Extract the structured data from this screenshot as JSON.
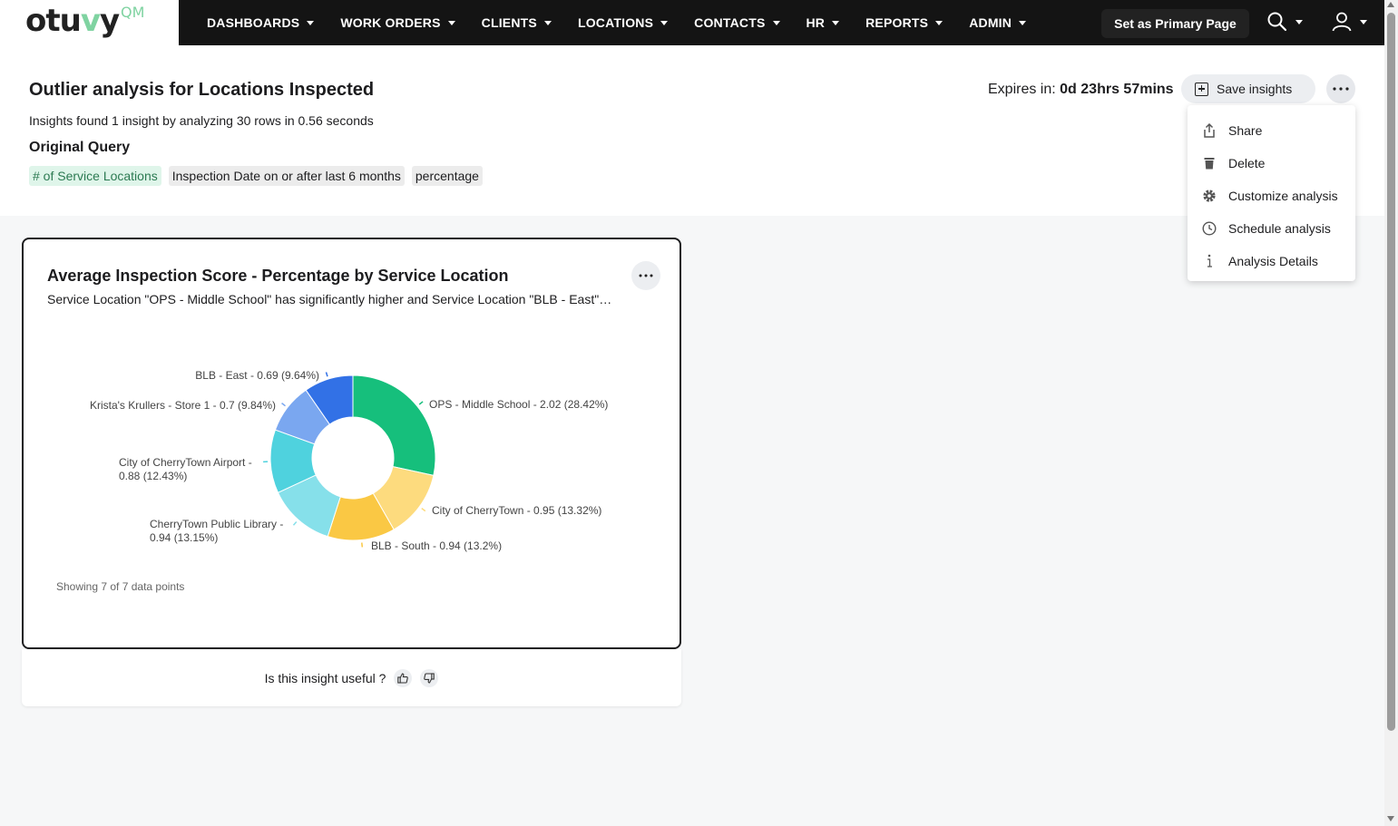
{
  "brand": {
    "logo_main": "otu",
    "logo_v": "v",
    "logo_end": "y",
    "logo_suffix": "QM"
  },
  "nav": {
    "items": [
      {
        "label": "DASHBOARDS"
      },
      {
        "label": "WORK ORDERS"
      },
      {
        "label": "CLIENTS"
      },
      {
        "label": "LOCATIONS"
      },
      {
        "label": "CONTACTS"
      },
      {
        "label": "HR"
      },
      {
        "label": "REPORTS"
      },
      {
        "label": "ADMIN"
      }
    ],
    "primary_page_label": "Set as Primary Page",
    "search_icon": "search-icon",
    "user_icon": "user-icon"
  },
  "header": {
    "title": "Outlier analysis for Locations Inspected",
    "summary": "Insights found 1 insight by analyzing 30 rows in 0.56 seconds",
    "original_query_label": "Original Query",
    "chips": [
      "# of Service Locations",
      "Inspection Date on or after last 6 months",
      "percentage"
    ],
    "expires_label": "Expires in:",
    "expires_value": "0d 23hrs 57mins",
    "save_label": "Save insights"
  },
  "menu": {
    "items": [
      {
        "label": "Share",
        "icon": "share-icon"
      },
      {
        "label": "Delete",
        "icon": "trash-icon"
      },
      {
        "label": "Customize analysis",
        "icon": "gear-icon"
      },
      {
        "label": "Schedule analysis",
        "icon": "clock-icon"
      },
      {
        "label": "Analysis Details",
        "icon": "info-icon"
      }
    ]
  },
  "card": {
    "title": "Average Inspection Score - Percentage by Service Location",
    "subtitle": "Service Location \"OPS - Middle School\" has significantly higher and Service Location \"BLB - East\" has significantly lower Average Inspection Score - Percentage than the rest",
    "showing": "Showing 7 of 7 data points",
    "feedback_label": "Is this insight useful ?"
  },
  "chart_data": {
    "type": "pie",
    "title": "Average Inspection Score - Percentage by Service Location",
    "donut": true,
    "slices": [
      {
        "name": "OPS - Middle School",
        "value": 2.02,
        "percent": 28.42,
        "label": "OPS - Middle School - 2.02 (28.42%)",
        "color": "#16bf7c"
      },
      {
        "name": "City of CherryTown",
        "value": 0.95,
        "percent": 13.32,
        "label": "City of CherryTown - 0.95 (13.32%)",
        "color": "#fddb7e"
      },
      {
        "name": "BLB - South",
        "value": 0.94,
        "percent": 13.2,
        "label": "BLB - South - 0.94 (13.2%)",
        "color": "#fac844"
      },
      {
        "name": "CherryTown Public Library",
        "value": 0.94,
        "percent": 13.15,
        "label": "CherryTown Public Library - 0.94 (13.15%)",
        "color": "#86e0ea"
      },
      {
        "name": "City of CherryTown Airport",
        "value": 0.88,
        "percent": 12.43,
        "label": "City of CherryTown Airport - 0.88 (12.43%)",
        "color": "#4fd2de"
      },
      {
        "name": "Krista's Krullers - Store 1",
        "value": 0.7,
        "percent": 9.84,
        "label": "Krista's Krullers - Store 1 - 0.7 (9.84%)",
        "color": "#7aa7f0"
      },
      {
        "name": "BLB - East",
        "value": 0.69,
        "percent": 9.64,
        "label": "BLB - East - 0.69 (9.64%)",
        "color": "#3271e6"
      }
    ]
  }
}
